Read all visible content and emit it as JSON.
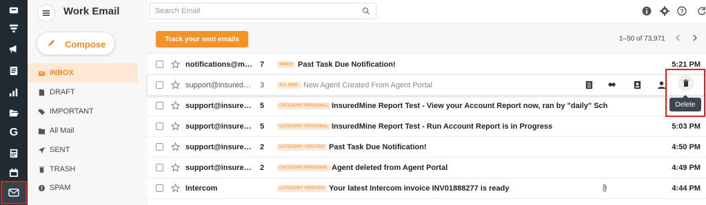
{
  "app": {
    "title": "Work Email"
  },
  "compose": {
    "label": "Compose"
  },
  "folders": [
    {
      "label": "INBOX",
      "icon": "inbox-icon",
      "active": true
    },
    {
      "label": "DRAFT",
      "icon": "draft-icon"
    },
    {
      "label": "IMPORTANT",
      "icon": "tag-icon"
    },
    {
      "label": "All Mail",
      "icon": "all-mail-icon"
    },
    {
      "label": "SENT",
      "icon": "send-icon"
    },
    {
      "label": "TRASH",
      "icon": "trash-icon"
    },
    {
      "label": "SPAM",
      "icon": "spam-icon"
    }
  ],
  "search": {
    "placeholder": "Search Email"
  },
  "toolbar": {
    "track_label": "Track your sent emails",
    "pager_text": "1–50 of 73,971"
  },
  "colors": {
    "accent": "#f39226",
    "rail": "#1f2a33",
    "active_folder_bg": "#fde8d6",
    "highlight": "#e02020"
  },
  "emails": [
    {
      "sender": "notifications@mai...",
      "count": "7",
      "label": "INBOX",
      "subject": "Past Task Due Notification!",
      "time": "5:21 PM",
      "read": false
    },
    {
      "sender": "support@insuredm...",
      "count": "3",
      "label": "ALL MAIL",
      "subject": "New Agent Created From Agent Portal",
      "time": "",
      "read": true
    },
    {
      "sender": "support@insured...",
      "count": "5",
      "label": "CATEGORY PERSONAL",
      "subject": "InsuredMine Report Test - View your Account Report now, ran by \"daily\" Sche...",
      "time": "",
      "read": false
    },
    {
      "sender": "support@insured...",
      "count": "5",
      "label": "CATEGORY PERSONAL",
      "subject": "InsuredMine Report Test - Run Account Report is in Progress",
      "time": "5:03 PM",
      "read": false
    },
    {
      "sender": "support@insured...",
      "count": "2",
      "label": "CATEGORY UPDATES",
      "subject": "Past Task Due Notification!",
      "time": "4:50 PM",
      "read": false
    },
    {
      "sender": "support@insured...",
      "count": "2",
      "label": "CATEGORY PERSONAL",
      "subject": "Agent deleted from Agent Portal",
      "time": "4:49 PM",
      "read": false
    },
    {
      "sender": "Intercom",
      "count": "",
      "label": "CATEGORY UPDATES",
      "subject": "Your latest Intercom invoice INV01888277 is ready",
      "time": "4:44 PM",
      "read": false
    }
  ],
  "tooltip": {
    "delete": "Delete"
  }
}
